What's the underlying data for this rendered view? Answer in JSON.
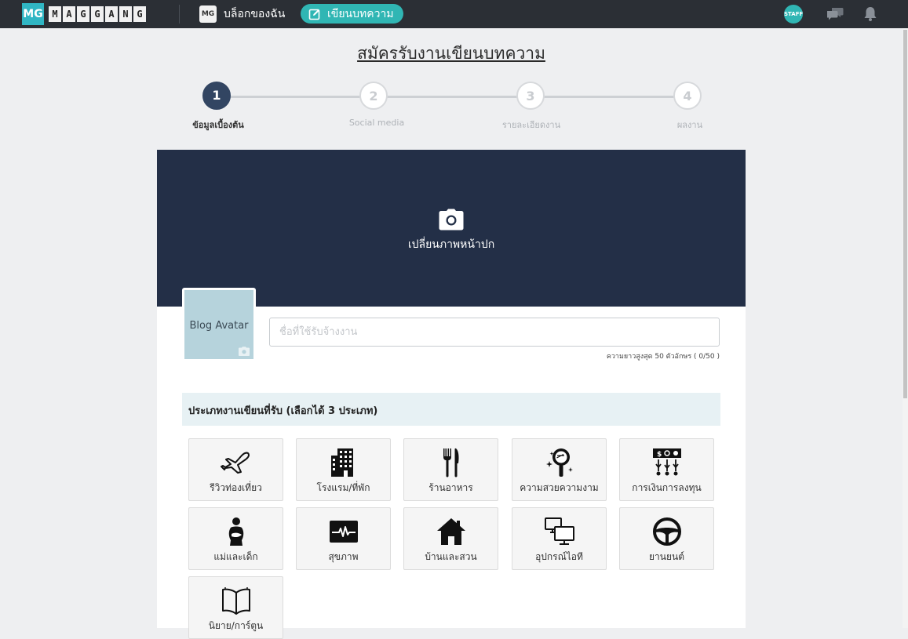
{
  "header": {
    "logo_mark": "MG",
    "logo_letters": [
      "M",
      "A",
      "G",
      "G",
      "A",
      "N",
      "G"
    ],
    "blog_icon_text": "MG",
    "blog_link_label": "บล็อกของฉัน",
    "write_button_label": "เขียนบทความ",
    "staff_badge": "STAFF"
  },
  "page": {
    "title": "สมัครรับงานเขียนบทความ"
  },
  "steps": [
    {
      "number": "1",
      "label": "ข้อมูลเบื้องต้น",
      "active": true
    },
    {
      "number": "2",
      "label": "Social media",
      "active": false
    },
    {
      "number": "3",
      "label": "รายละเอียดงาน",
      "active": false
    },
    {
      "number": "4",
      "label": "ผลงาน",
      "active": false
    }
  ],
  "cover": {
    "label": "เปลี่ยนภาพหน้าปก"
  },
  "avatar": {
    "label": "Blog Avatar"
  },
  "name_field": {
    "placeholder": "ชื่อที่ใช้รับจ้างงาน",
    "value": "",
    "hint": "ความยาวสูงสุด 50 ตัวอักษร ( 0/50 )"
  },
  "categories_section": {
    "title": "ประเภทงานเขียนที่รับ (เลือกได้ 3 ประเภท)",
    "items": [
      {
        "label": "รีวิวท่องเที่ยว",
        "icon": "airplane-icon"
      },
      {
        "label": "โรงแรม/ที่พัก",
        "icon": "building-icon"
      },
      {
        "label": "ร้านอาหาร",
        "icon": "fork-knife-icon"
      },
      {
        "label": "ความสวยความงาม",
        "icon": "mirror-sparkle-icon"
      },
      {
        "label": "การเงินการลงทุน",
        "icon": "finance-icon"
      },
      {
        "label": "แม่และเด็ก",
        "icon": "mother-baby-icon"
      },
      {
        "label": "สุขภาพ",
        "icon": "heartbeat-icon"
      },
      {
        "label": "บ้านและสวน",
        "icon": "house-icon"
      },
      {
        "label": "อุปกรณ์ไอที",
        "icon": "computer-devices-icon"
      },
      {
        "label": "ยานยนต์",
        "icon": "steering-wheel-icon"
      },
      {
        "label": "นิยาย/การ์ตูน",
        "icon": "open-book-icon"
      }
    ]
  },
  "colors": {
    "topbar": "#2b2f35",
    "accent": "#30b6b4",
    "cover": "#232f47",
    "step_active": "#324562"
  }
}
